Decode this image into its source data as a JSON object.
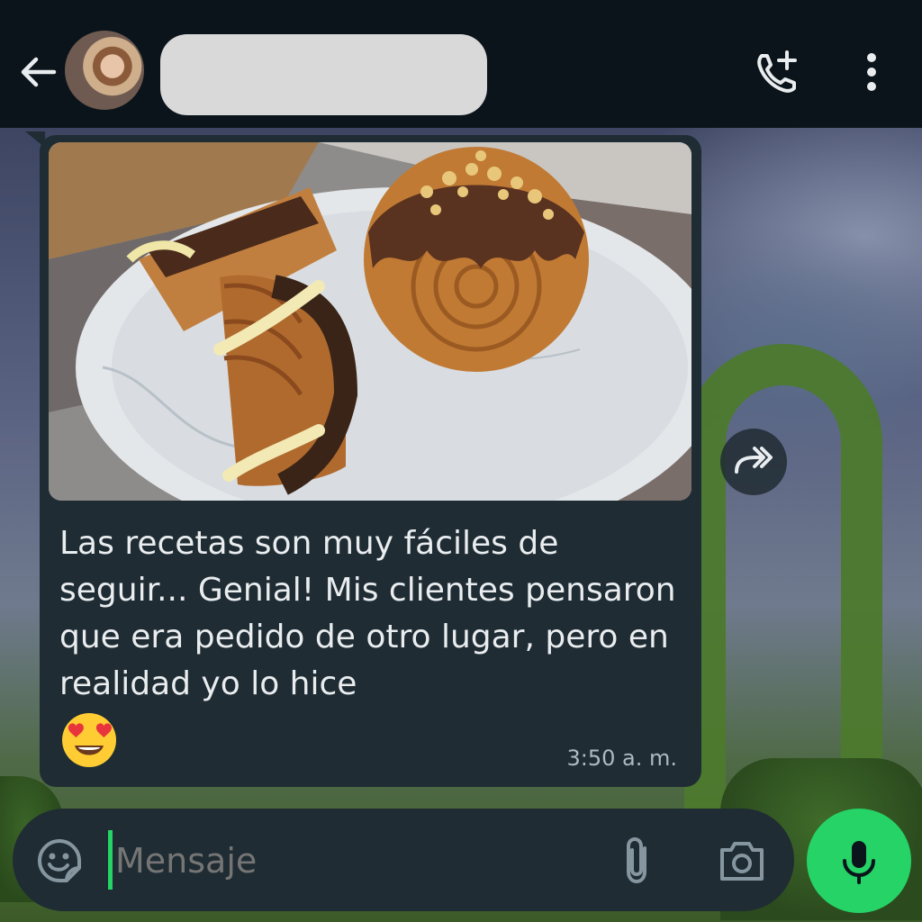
{
  "header": {
    "back_icon": "arrow-left-icon",
    "call_icon": "phone-add-icon",
    "menu_icon": "more-vert-icon"
  },
  "message": {
    "text": "Las recetas son muy fáciles de seguir... Genial! Mis clientes pensaron que era pedido de otro lugar, pero en realidad yo lo hice",
    "emoji": "😍",
    "time": "3:50 a. m.",
    "forward_icon": "forward-icon"
  },
  "composer": {
    "placeholder": "Mensaje",
    "emoji_icon": "sticker-emoji-icon",
    "attach_icon": "paperclip-icon",
    "camera_icon": "camera-icon",
    "mic_icon": "microphone-icon"
  },
  "colors": {
    "header_bg": "#0b141a",
    "bubble_bg": "#1f2c33",
    "accent": "#25d366",
    "text": "#e9edef",
    "muted": "#8696a0"
  }
}
